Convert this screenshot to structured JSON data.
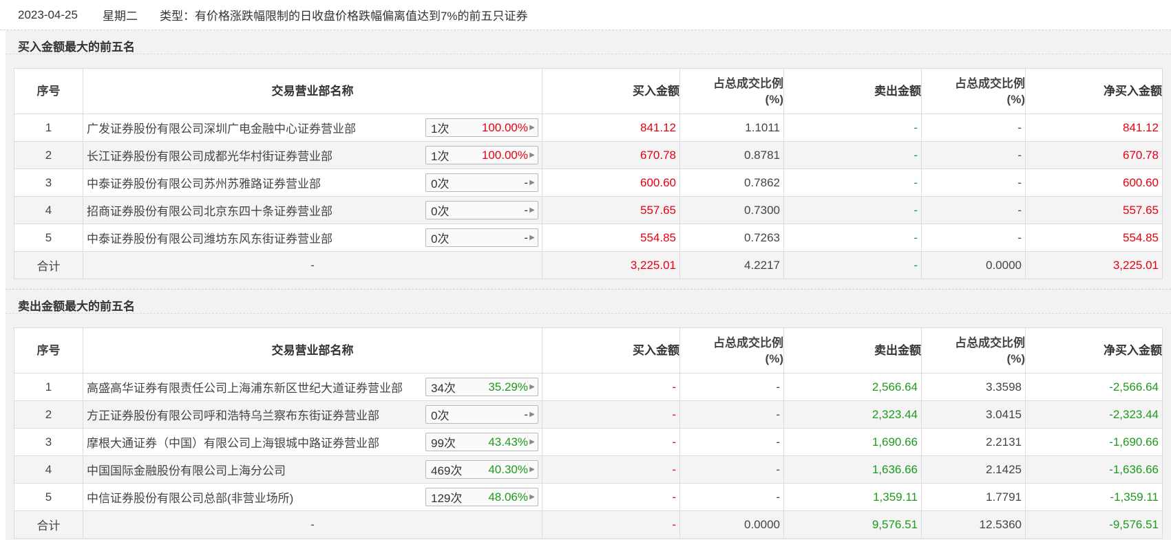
{
  "header": {
    "date": "2023-04-25",
    "weekday": "星期二",
    "type_text": "类型：有价格涨跌幅限制的日收盘价格跌幅偏离值达到7%的前五只证券"
  },
  "columns": {
    "idx": "序号",
    "name": "交易营业部名称",
    "buy": "买入金额",
    "buy_pct_l1": "占总成交比例",
    "buy_pct_l2": "(%)",
    "sell": "卖出金额",
    "sell_pct_l1": "占总成交比例",
    "sell_pct_l2": "(%)",
    "net": "净买入金额"
  },
  "buy_section": {
    "title": "买入金额最大的前五名",
    "rows": [
      {
        "idx": "1",
        "name": "广发证券股份有限公司深圳广电金融中心证券营业部",
        "count": "1次",
        "rate": "100.00%",
        "buy": "841.12",
        "buy_pct": "1.1011",
        "sell": "-",
        "sell_pct": "-",
        "net": "841.12"
      },
      {
        "idx": "2",
        "name": "长江证券股份有限公司成都光华村街证券营业部",
        "count": "1次",
        "rate": "100.00%",
        "buy": "670.78",
        "buy_pct": "0.8781",
        "sell": "-",
        "sell_pct": "-",
        "net": "670.78"
      },
      {
        "idx": "3",
        "name": "中泰证券股份有限公司苏州苏雅路证券营业部",
        "count": "0次",
        "rate": "-",
        "buy": "600.60",
        "buy_pct": "0.7862",
        "sell": "-",
        "sell_pct": "-",
        "net": "600.60"
      },
      {
        "idx": "4",
        "name": "招商证券股份有限公司北京东四十条证券营业部",
        "count": "0次",
        "rate": "-",
        "buy": "557.65",
        "buy_pct": "0.7300",
        "sell": "-",
        "sell_pct": "-",
        "net": "557.65"
      },
      {
        "idx": "5",
        "name": "中泰证券股份有限公司潍坊东风东街证券营业部",
        "count": "0次",
        "rate": "-",
        "buy": "554.85",
        "buy_pct": "0.7263",
        "sell": "-",
        "sell_pct": "-",
        "net": "554.85"
      }
    ],
    "total": {
      "label": "合计",
      "name": "-",
      "buy": "3,225.01",
      "buy_pct": "4.2217",
      "sell": "-",
      "sell_pct": "0.0000",
      "net": "3,225.01"
    }
  },
  "sell_section": {
    "title": "卖出金额最大的前五名",
    "rows": [
      {
        "idx": "1",
        "name": "高盛高华证券有限责任公司上海浦东新区世纪大道证券营业部",
        "count": "34次",
        "rate": "35.29%",
        "buy": "-",
        "buy_pct": "-",
        "sell": "2,566.64",
        "sell_pct": "3.3598",
        "net": "-2,566.64"
      },
      {
        "idx": "2",
        "name": "方正证券股份有限公司呼和浩特乌兰察布东街证券营业部",
        "count": "0次",
        "rate": "-",
        "buy": "-",
        "buy_pct": "-",
        "sell": "2,323.44",
        "sell_pct": "3.0415",
        "net": "-2,323.44"
      },
      {
        "idx": "3",
        "name": "摩根大通证券（中国）有限公司上海银城中路证券营业部",
        "count": "99次",
        "rate": "43.43%",
        "buy": "-",
        "buy_pct": "-",
        "sell": "1,690.66",
        "sell_pct": "2.2131",
        "net": "-1,690.66"
      },
      {
        "idx": "4",
        "name": "中国国际金融股份有限公司上海分公司",
        "count": "469次",
        "rate": "40.30%",
        "buy": "-",
        "buy_pct": "-",
        "sell": "1,636.66",
        "sell_pct": "2.1425",
        "net": "-1,636.66"
      },
      {
        "idx": "5",
        "name": "中信证券股份有限公司总部(非营业场所)",
        "count": "129次",
        "rate": "48.06%",
        "buy": "-",
        "buy_pct": "-",
        "sell": "1,359.11",
        "sell_pct": "1.7791",
        "net": "-1,359.11"
      }
    ],
    "total": {
      "label": "合计",
      "name": "-",
      "buy": "-",
      "buy_pct": "0.0000",
      "sell": "9,576.51",
      "sell_pct": "12.5360",
      "net": "-9,576.51"
    }
  },
  "colors": {
    "up": "#e60012",
    "down": "#1e9b1e"
  },
  "icons": {
    "expand": "caret-right-icon"
  }
}
